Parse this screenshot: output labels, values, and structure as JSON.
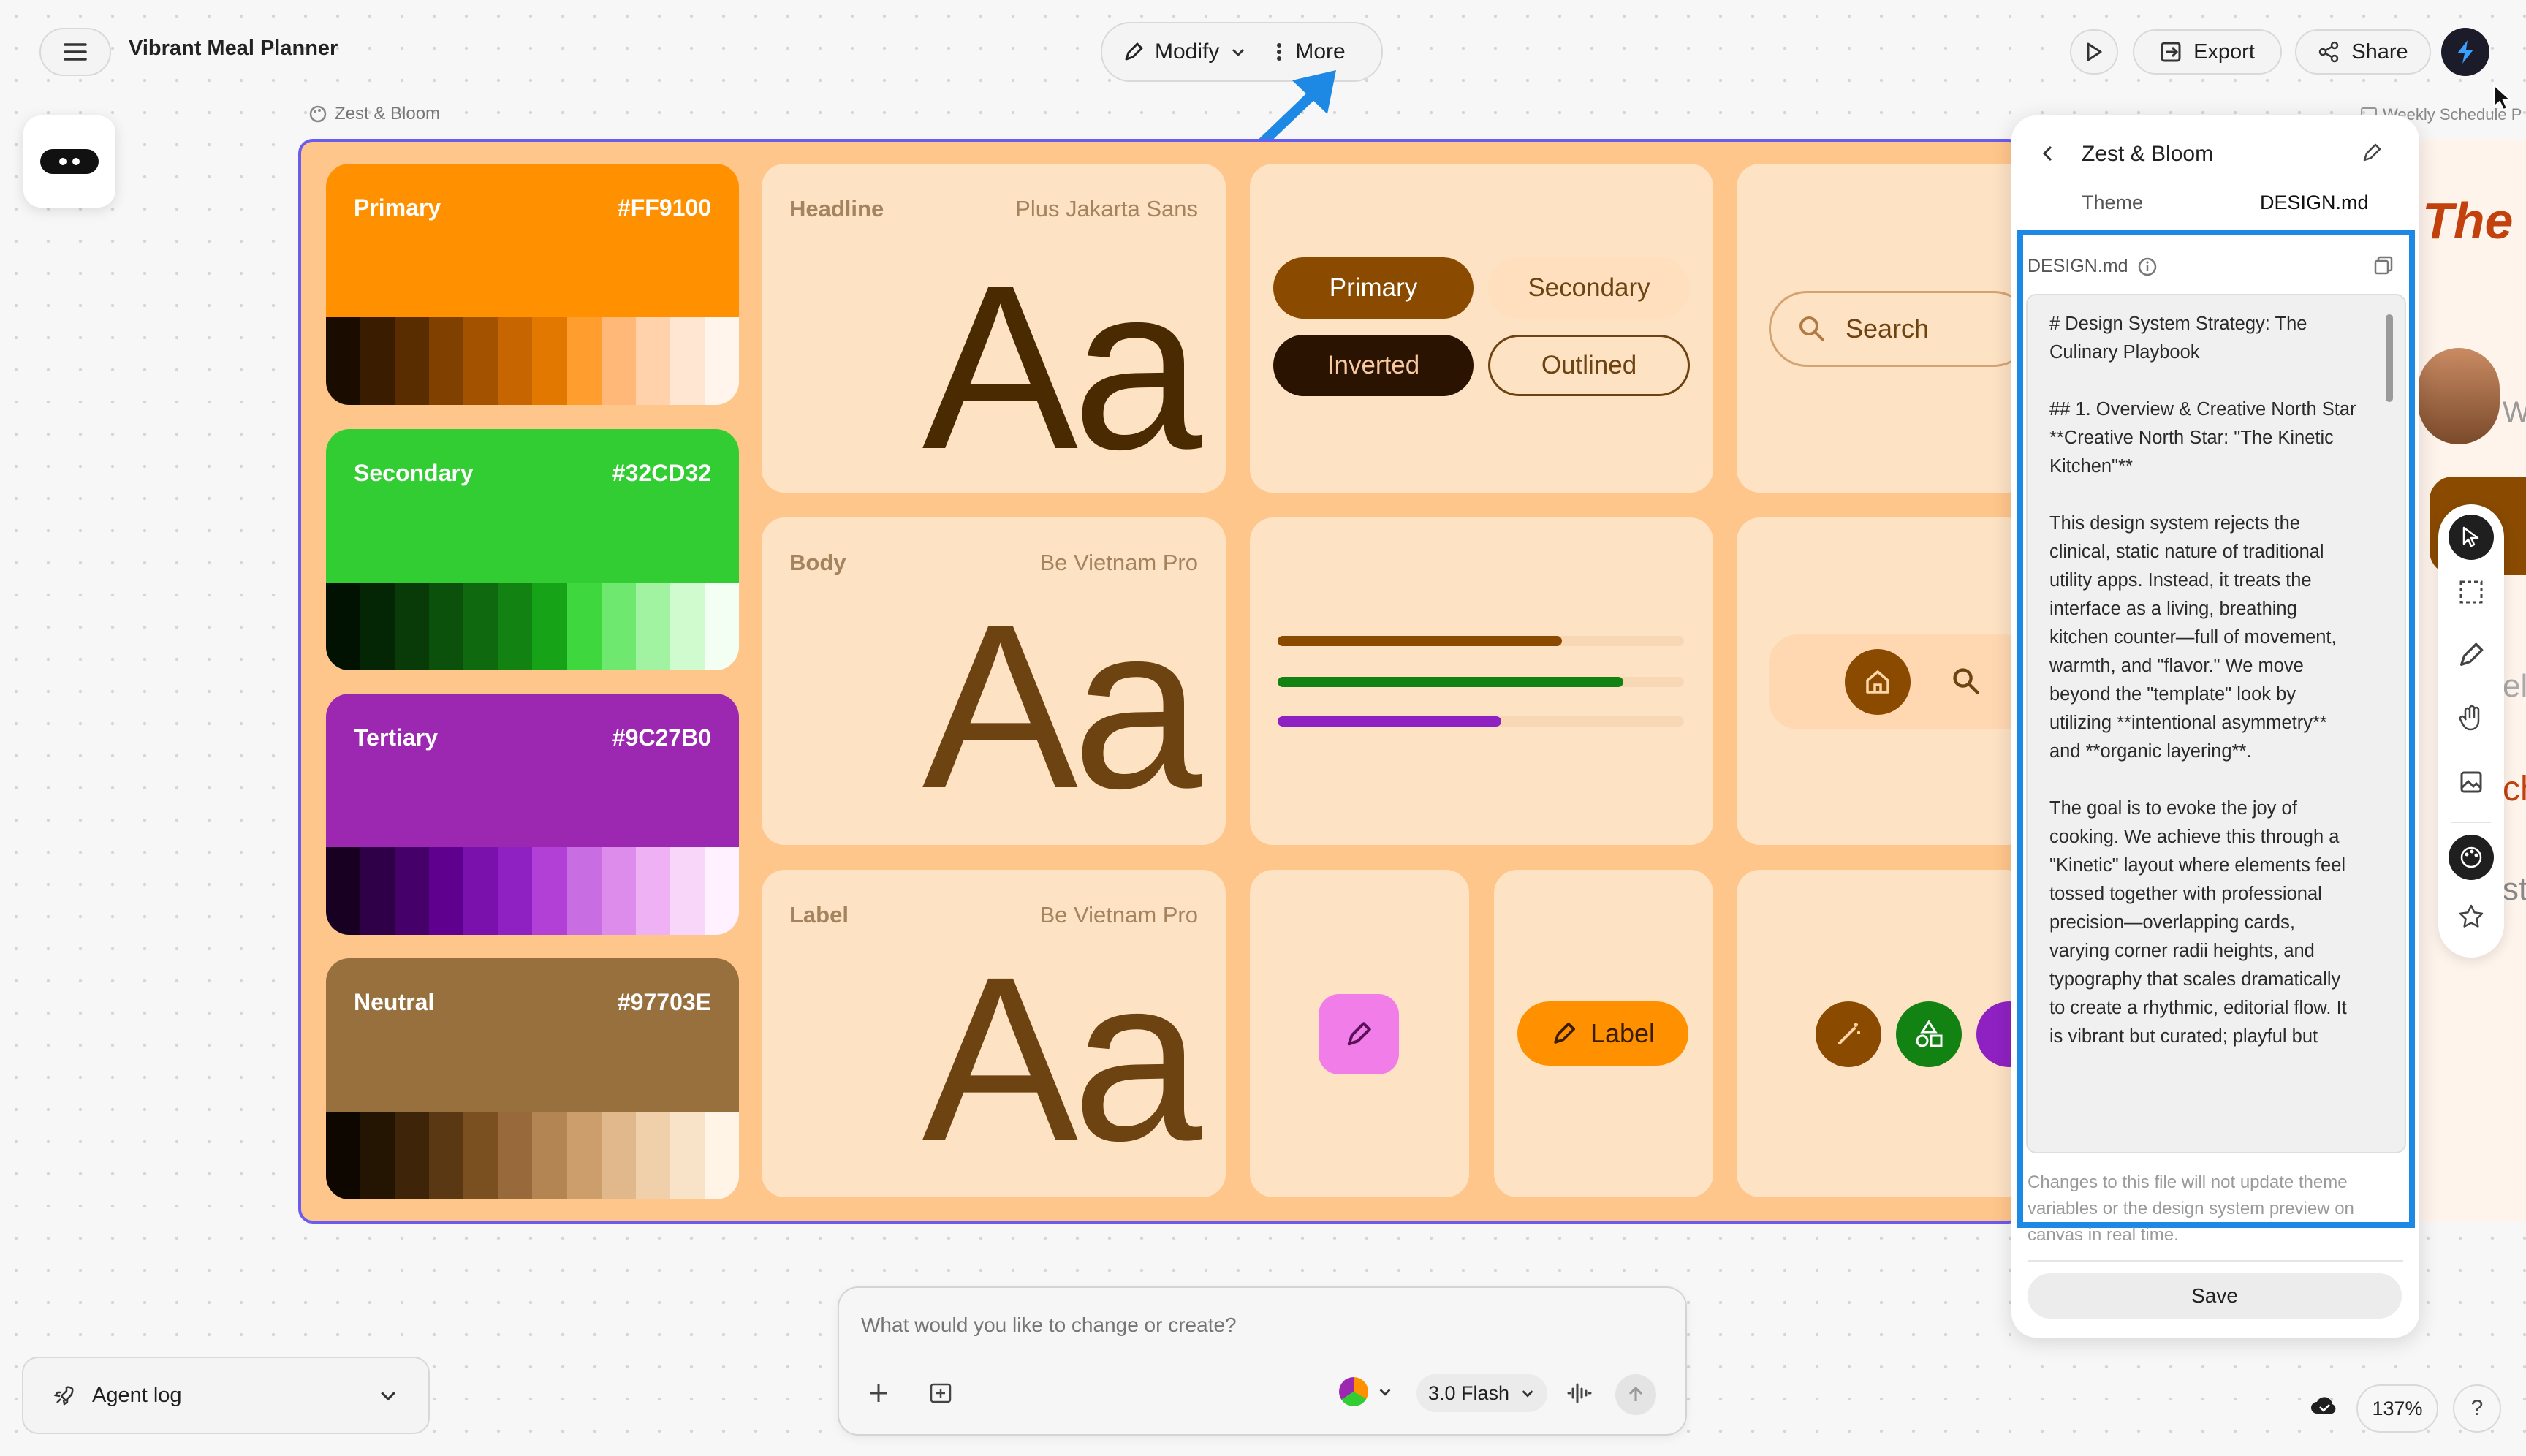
{
  "app": {
    "title": "Vibrant Meal Planner"
  },
  "toolbar": {
    "modify_label": "Modify",
    "more_label": "More",
    "export_label": "Export",
    "share_label": "Share"
  },
  "canvas": {
    "frame_label": "Zest & Bloom",
    "right_frame_label": "Weekly Schedule P",
    "colors": [
      {
        "name": "Primary",
        "hex": "#FF9100",
        "shades": [
          "#1b0c00",
          "#3a1c00",
          "#5a2d00",
          "#7f4000",
          "#a35300",
          "#c76600",
          "#e27800",
          "#ff9e2e",
          "#ffb877",
          "#ffd2ab",
          "#ffe6d2",
          "#fff5ec"
        ]
      },
      {
        "name": "Secondary",
        "hex": "#32CD32",
        "shades": [
          "#021202",
          "#052605",
          "#083b08",
          "#0b510b",
          "#0f690f",
          "#128212",
          "#17a317",
          "#3ed83e",
          "#6ee86e",
          "#a1f3a1",
          "#cffbcf",
          "#f2fff2"
        ]
      },
      {
        "name": "Tertiary",
        "hex": "#9C27B0",
        "shades": [
          "#170021",
          "#2f0047",
          "#46006a",
          "#5f008f",
          "#7b11ad",
          "#8f21c2",
          "#b23fd6",
          "#c96de2",
          "#dd8cec",
          "#eeb1f4",
          "#f8d6fa",
          "#fff1ff"
        ]
      },
      {
        "name": "Neutral",
        "hex": "#97703E",
        "shades": [
          "#0e0700",
          "#241402",
          "#3e2509",
          "#5a3813",
          "#7a5020",
          "#98693a",
          "#b28552",
          "#cb9e6b",
          "#e1b88b",
          "#efd0ab",
          "#f8e3c9",
          "#fff4e6"
        ]
      }
    ],
    "typography": [
      {
        "role": "Headline",
        "font": "Plus Jakarta Sans",
        "sample": "Aa"
      },
      {
        "role": "Body",
        "font": "Be Vietnam Pro",
        "sample": "Aa"
      },
      {
        "role": "Label",
        "font": "Be Vietnam Pro",
        "sample": "Aa"
      }
    ],
    "buttons": {
      "primary": "Primary",
      "secondary": "Secondary",
      "inverted": "Inverted",
      "outlined": "Outlined"
    },
    "search_placeholder": "Search",
    "progress": [
      {
        "value": 0.7,
        "color": "#8a4a00"
      },
      {
        "value": 0.85,
        "color": "#128212"
      },
      {
        "value": 0.55,
        "color": "#8f21c2"
      }
    ],
    "chip_label": "Label"
  },
  "design_panel": {
    "title": "Zest & Bloom",
    "tabs": [
      "Theme",
      "DESIGN.md"
    ],
    "file_label": "DESIGN.md",
    "content": "# Design System Strategy: The Culinary Playbook\n\n## 1. Overview & Creative North Star\n**Creative North Star: \"The Kinetic Kitchen\"**\n\nThis design system rejects the clinical, static nature of traditional utility apps. Instead, it treats the interface as a living, breathing kitchen counter—full of movement, warmth, and \"flavor.\" We move beyond the \"template\" look by utilizing **intentional asymmetry** and **organic layering**.\n\nThe goal is to evoke the joy of cooking. We achieve this through a \"Kinetic\" layout where elements feel tossed together with professional precision—overlapping cards, varying corner radii heights, and typography that scales dramatically to create a rhythmic, editorial flow. It is vibrant but curated; playful but",
    "notice": "Changes to this file will not update theme variables or the design system preview on canvas in real time.",
    "save_label": "Save"
  },
  "preview": {
    "headline_fragment": "The K",
    "text_frag_1": "W",
    "text_frag_2": "ele",
    "text_frag_3": "ch",
    "text_frag_4": "st"
  },
  "prompt": {
    "placeholder": "What would you like to change or create?",
    "model": "3.0 Flash"
  },
  "agent_log": {
    "label": "Agent log"
  },
  "zoom": {
    "value": "137%"
  },
  "help": {
    "label": "?"
  },
  "accent": {
    "highlight": "#1e88e5",
    "selection": "#6b5cf0"
  }
}
